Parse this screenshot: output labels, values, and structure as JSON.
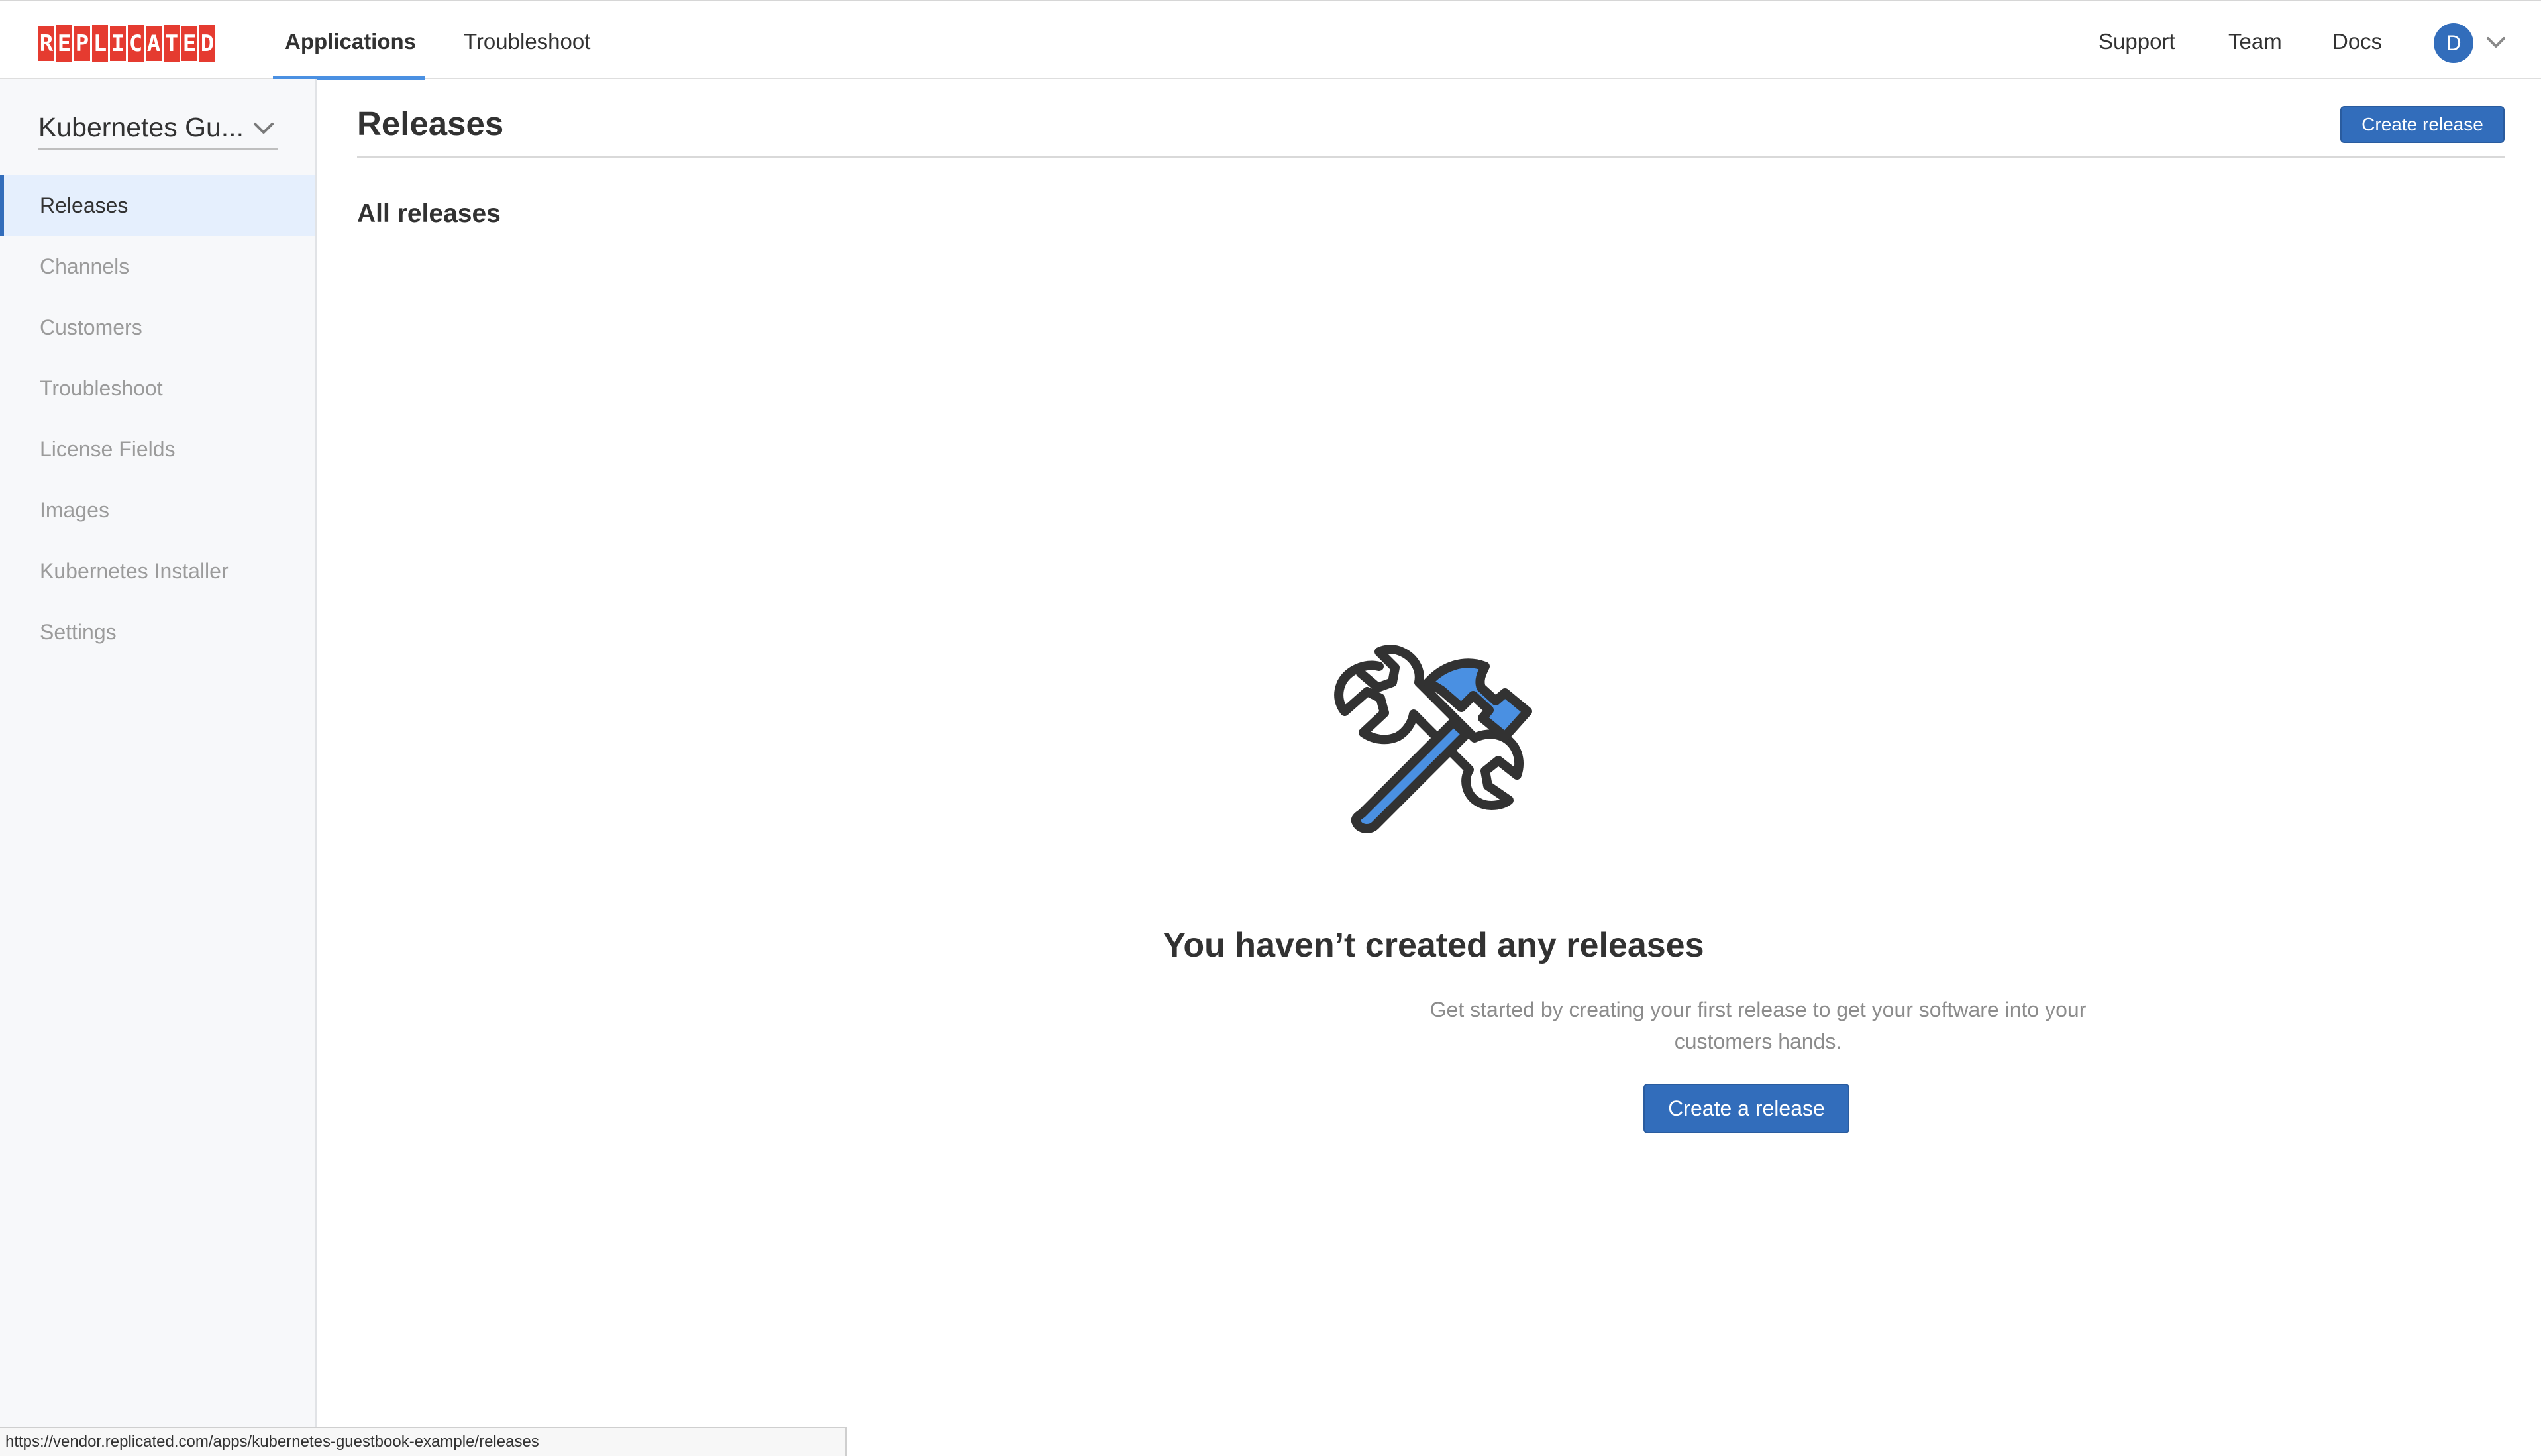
{
  "brand": {
    "letters": [
      "R",
      "E",
      "P",
      "L",
      "I",
      "C",
      "A",
      "T",
      "E",
      "D"
    ],
    "accent": "#e53b30"
  },
  "topnav": {
    "items": [
      {
        "label": "Applications",
        "active": true
      },
      {
        "label": "Troubleshoot",
        "active": false
      }
    ],
    "right_links": [
      "Support",
      "Team",
      "Docs"
    ],
    "avatar_initial": "D",
    "avatar_color": "#326dbb",
    "active_underline_color": "#4a90e2"
  },
  "sidebar": {
    "app_name": "Kubernetes Gu...",
    "items": [
      {
        "label": "Releases",
        "active": true
      },
      {
        "label": "Channels",
        "active": false
      },
      {
        "label": "Customers",
        "active": false
      },
      {
        "label": "Troubleshoot",
        "active": false
      },
      {
        "label": "License Fields",
        "active": false
      },
      {
        "label": "Images",
        "active": false
      },
      {
        "label": "Kubernetes Installer",
        "active": false
      },
      {
        "label": "Settings",
        "active": false
      }
    ]
  },
  "main": {
    "title": "Releases",
    "create_button": "Create release",
    "section_title": "All releases",
    "empty_state": {
      "icon": "wrench-hammer-icon",
      "heading": "You haven’t created any releases",
      "description": "Get started by creating your first release to get your software into your customers hands.",
      "button": "Create a release"
    }
  },
  "statusbar": {
    "url": "https://vendor.replicated.com/apps/kubernetes-guestbook-example/releases"
  }
}
